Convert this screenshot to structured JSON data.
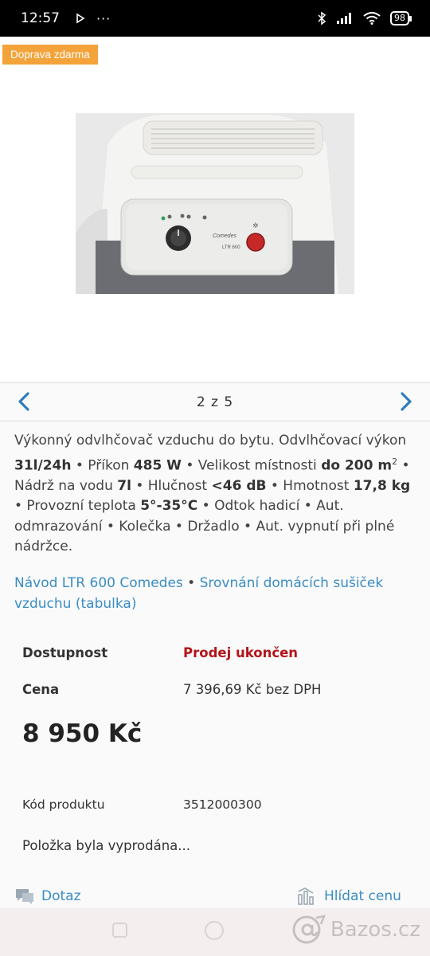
{
  "status_bar": {
    "time": "12:57",
    "battery": "98",
    "icons": [
      "play-icon",
      "more-icon",
      "bluetooth-icon",
      "signal-icon",
      "wifi-icon",
      "battery-icon"
    ]
  },
  "badge": "Doprava zdarma",
  "pager": {
    "text": "2 z 5"
  },
  "description": {
    "p1": "Výkonný odvlhčovač vzduchu do bytu. Odvlhčovací výkon ",
    "b1": "31l/24h",
    "p2": " • Příkon ",
    "b2": "485 W",
    "p3": " • Velikost místnosti ",
    "b3": "do 200 m",
    "sup": "2",
    "p4": " • Nádrž na vodu ",
    "b4": "7l",
    "p5": " • Hlučnost ",
    "b5": "<46 dB",
    "p6": " • Hmotnost ",
    "b6": "17,8 kg",
    "p7": " • Provozní teplota ",
    "b7": "5°-35°C",
    "p8": " • Odtok hadicí • Aut. odmrazování • Kolečka • Držadlo • Aut. vypnutí při plné nádržce."
  },
  "links": {
    "manual": "Návod LTR 600 Comedes",
    "separator": " • ",
    "comparison": "Srovnání domácích sušiček vzduchu (tabulka)"
  },
  "details": {
    "availability_label": "Dostupnost",
    "availability_value": "Prodej ukončen",
    "price_label": "Cena",
    "price_net": "7 396,69 Kč bez DPH",
    "price": "8 950 Kč",
    "code_label": "Kód produktu",
    "code_value": "3512000300",
    "sold_out": "Položka byla vyprodána..."
  },
  "actions": {
    "question": "Dotaz",
    "watch_price": "Hlídat cenu"
  },
  "photo": {
    "brand": "Comedes",
    "model": "LTR 600"
  },
  "watermark": "Bazos.cz",
  "colors": {
    "badge": "#f3a33a",
    "link": "#3a8dc4",
    "status": "#b3141a",
    "arrow": "#2f7cc0"
  }
}
